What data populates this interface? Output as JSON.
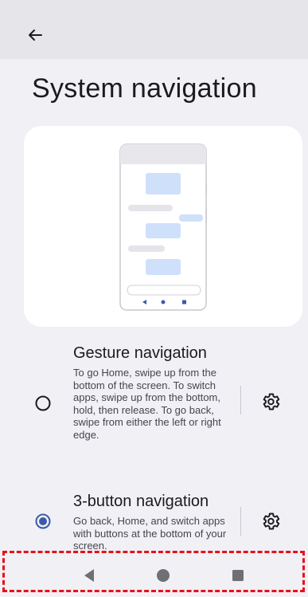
{
  "header": {
    "back_icon": "arrow-back-icon",
    "title": "System navigation"
  },
  "options": [
    {
      "title": "Gesture navigation",
      "description": "To go Home, swipe up from the bottom of the screen. To switch apps, swipe up from the bottom, hold, then release. To go back, swipe from either the left or right edge.",
      "selected": false,
      "settings_icon": "gear-icon"
    },
    {
      "title": "3-button navigation",
      "description": "Go back, Home, and switch apps with buttons at the bottom of your screen.",
      "selected": true,
      "settings_icon": "gear-icon"
    }
  ],
  "nav_bar": {
    "back_icon": "triangle-back-icon",
    "home_icon": "circle-home-icon",
    "recents_icon": "square-recents-icon"
  },
  "colors": {
    "background": "#f0f0f5",
    "header_bg": "#e6e6ea",
    "accent": "#3b5ba9",
    "illustration_blue": "#cfe0fb",
    "annotation_red": "#e8101a"
  }
}
